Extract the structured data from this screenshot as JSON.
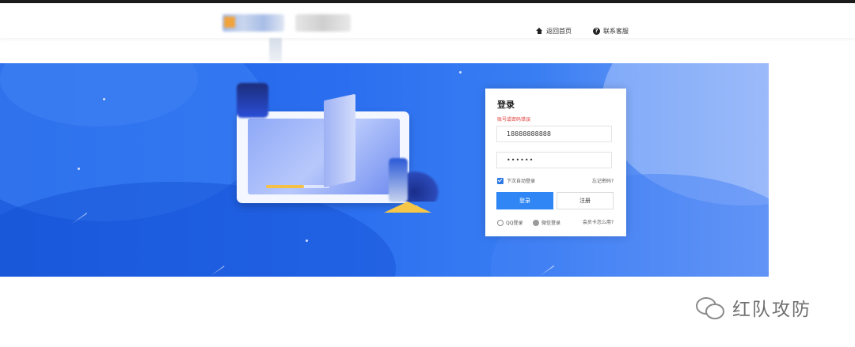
{
  "header": {
    "nav": [
      {
        "label": "返回首页",
        "icon": "home-icon"
      },
      {
        "label": "联系客服",
        "icon": "help-icon"
      }
    ]
  },
  "login": {
    "title": "登录",
    "error": "账号或密码错误",
    "username_value": "18888888888",
    "password_value": "••••••",
    "remember_label": "下次自动登录",
    "remember_checked": true,
    "forgot_label": "忘记密码?",
    "login_button": "登录",
    "register_button": "注册",
    "social": [
      {
        "label": "QQ登录",
        "icon": "qq-icon"
      },
      {
        "label": "微信登录",
        "icon": "wechat-icon"
      }
    ],
    "howto_label": "会员卡怎么用?"
  },
  "watermark": {
    "text": "红队攻防",
    "icon": "wechat-icon"
  },
  "colors": {
    "primary_button": "#2f86f4",
    "error_text": "#e23d3d",
    "banner_blue": "#2b6ff0"
  }
}
